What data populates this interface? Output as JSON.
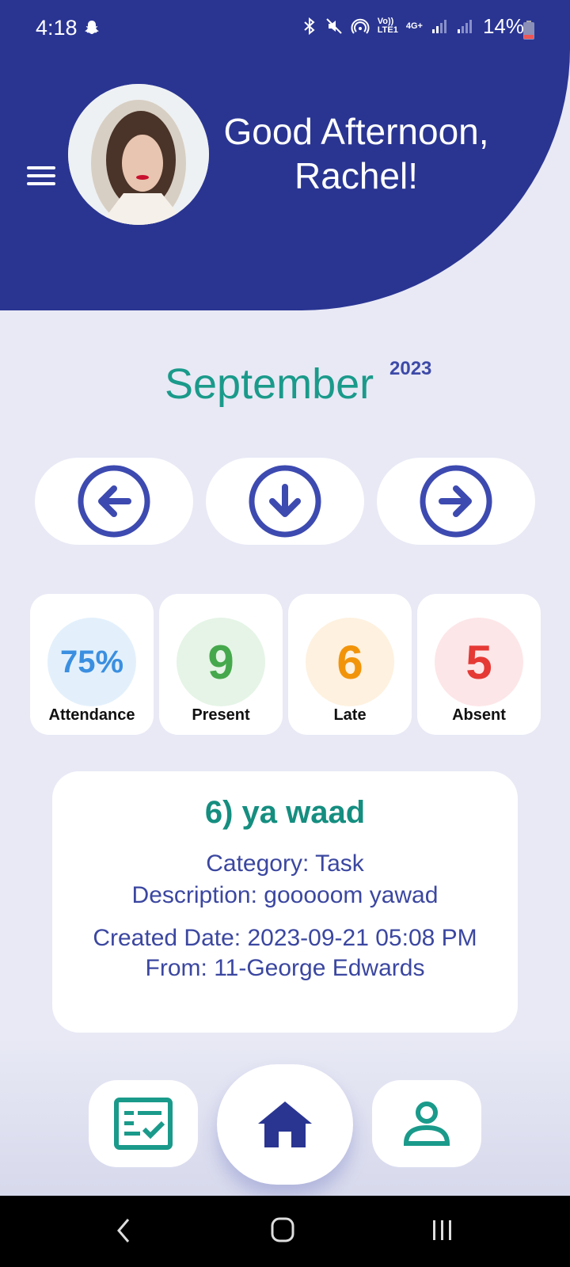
{
  "status_bar": {
    "time": "4:18",
    "network_top": "Vo))",
    "network_bottom": "LTE1",
    "gen": "4G+",
    "battery": "14%"
  },
  "header": {
    "greeting": "Good Afternoon,",
    "name": "Rachel!"
  },
  "calendar": {
    "month": "September",
    "year": "2023"
  },
  "nav_buttons": [
    {
      "icon": "arrow-left-circle-icon"
    },
    {
      "icon": "arrow-down-circle-icon"
    },
    {
      "icon": "arrow-right-circle-icon"
    }
  ],
  "stats": [
    {
      "value": "75%",
      "label": "Attendance",
      "color": "#3b8fe0",
      "bg": "#e3f0fc"
    },
    {
      "value": "9",
      "label": "Present",
      "color": "#46a84c",
      "bg": "#e5f4e6"
    },
    {
      "value": "6",
      "label": "Late",
      "color": "#f2940a",
      "bg": "#fef1df"
    },
    {
      "value": "5",
      "label": "Absent",
      "color": "#e53935",
      "bg": "#fde6e8"
    }
  ],
  "task": {
    "title": "6) ya waad",
    "category": "Category: Task",
    "description": "Description: gooooom yawad",
    "created": "Created Date: 2023-09-21 05:08 PM",
    "from": "From: 11-George Edwards"
  },
  "colors": {
    "primary": "#2a3592",
    "accent": "#1a9a8a",
    "background": "#e8e9f5"
  }
}
